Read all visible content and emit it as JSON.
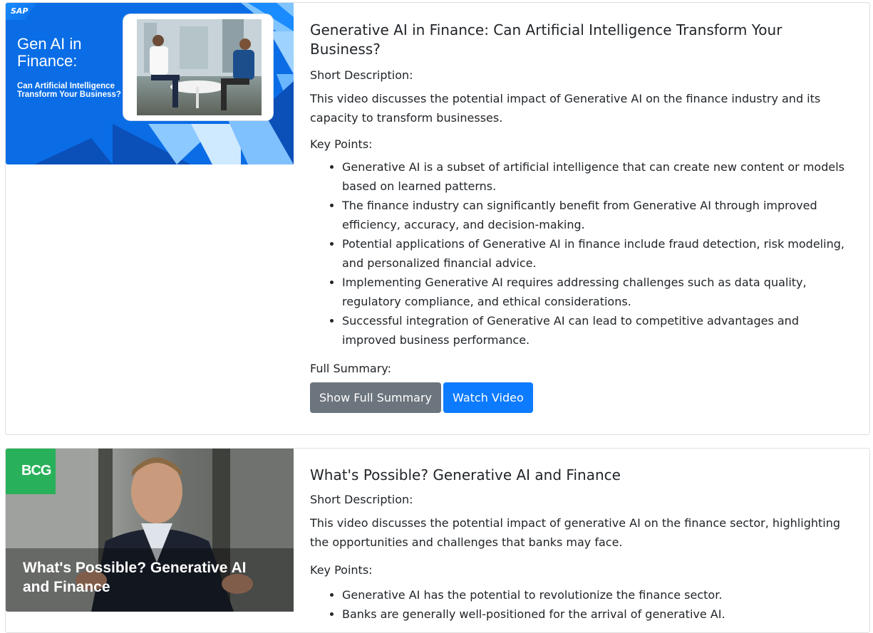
{
  "cards": [
    {
      "thumbnail": {
        "logo": "SAP",
        "title_line1": "Gen AI in",
        "title_line2": "Finance:",
        "subtitle": "Can Artificial Intelligence Transform Your Business?"
      },
      "title": "Generative AI in Finance: Can Artificial Intelligence Transform Your Business?",
      "short_label": "Short Description:",
      "short_description": "This video discusses the potential impact of Generative AI on the finance industry and its capacity to transform businesses.",
      "key_label": "Key Points:",
      "key_points": [
        "Generative AI is a subset of artificial intelligence that can create new content or models based on learned patterns.",
        "The finance industry can significantly benefit from Generative AI through improved efficiency, accuracy, and decision-making.",
        "Potential applications of Generative AI in finance include fraud detection, risk modeling, and personalized financial advice.",
        "Implementing Generative AI requires addressing challenges such as data quality, regulatory compliance, and ethical considerations.",
        "Successful integration of Generative AI can lead to competitive advantages and improved business performance."
      ],
      "full_label": "Full Summary:",
      "show_button": "Show Full Summary",
      "watch_button": "Watch Video"
    },
    {
      "thumbnail": {
        "logo": "BCG",
        "caption": "What's Possible? Generative AI and Finance"
      },
      "title": "What's Possible? Generative AI and Finance",
      "short_label": "Short Description:",
      "short_description": "This video discusses the potential impact of generative AI on the finance sector, highlighting the opportunities and challenges that banks may face.",
      "key_label": "Key Points:",
      "key_points": [
        "Generative AI has the potential to revolutionize the finance sector.",
        "Banks are generally well-positioned for the arrival of generative AI."
      ]
    }
  ]
}
